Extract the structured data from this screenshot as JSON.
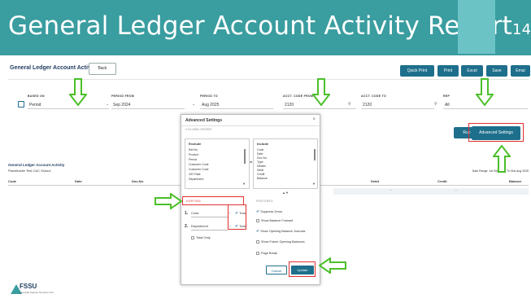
{
  "slide": {
    "title": "General Ledger Account Activity Report",
    "page_number": "14"
  },
  "app": {
    "title": "General Ledger Account Activity",
    "back_label": "Back",
    "toolbar": {
      "quick_print": "Quick Print",
      "print": "Print",
      "excel": "Excel",
      "save": "Save",
      "email": "Emai"
    },
    "filters": {
      "based_on_label": "BASED ON",
      "based_on_value": "Period",
      "period_from_label": "PERIOD FROM",
      "period_from_value": "Sep 2024",
      "period_to_label": "PERIOD TO",
      "period_to_value": "Aug 2025",
      "acct_from_label": "ACCT. CODE FROM",
      "acct_from_value": "2120",
      "acct_to_label": "ACCT. CODE TO",
      "acct_to_value": "2120",
      "rep_label": "REP",
      "rep_value": "All"
    },
    "run_label": "Run",
    "advanced_settings_label": "Advanced Settings",
    "report": {
      "title": "General Ledger Account Activity",
      "school": "Placeholder Test C&C School",
      "date_range": "Date Range: 1st Sep 2024 To 31st Aug 2025"
    },
    "columns": [
      "Code",
      "Date",
      "Doc.No.",
      "Debit",
      "Credit",
      "Balance"
    ],
    "dash": "-"
  },
  "dialog": {
    "title": "Advanced Settings",
    "close": "×",
    "column_order_label": "COLUMN ORDER",
    "exclude_label": "Exclude",
    "include_label": "Include",
    "exclude_items": [
      "Ref.No.",
      "Product",
      "Period",
      "Customer Code",
      "Customer Code",
      "VAT Rate",
      "Department"
    ],
    "include_items": [
      "Code",
      "Date",
      "Doc.No.",
      "Type",
      "Details",
      "Debit",
      "Credit",
      "Balance"
    ],
    "sorting_label": "SORTING",
    "features_label": "FEATURES",
    "sort_rows": [
      {
        "num": "1.",
        "value": "Code",
        "total": "Total"
      },
      {
        "num": "2.",
        "value": "Department",
        "total": "Total"
      }
    ],
    "total_only": "Total Only",
    "features": [
      {
        "label": "Suppress Zeros",
        "checked": true
      },
      {
        "label": "Show Balance Forward",
        "checked": false
      },
      {
        "label": "Show Opening Balance Journals",
        "checked": true
      },
      {
        "label": "Show Future Opening Balances",
        "checked": false
      },
      {
        "label": "Page Break",
        "checked": false
      }
    ],
    "cancel_label": "Cancel",
    "update_label": "Update"
  },
  "footer": {
    "logo_text": "FSSU",
    "logo_sub": "Financial Support Services Unit"
  },
  "colors": {
    "teal_banner": "#3a9da0",
    "button_blue": "#1e6f8c",
    "annotation_red": "#e03030",
    "arrow_green": "#4cbf2a"
  }
}
